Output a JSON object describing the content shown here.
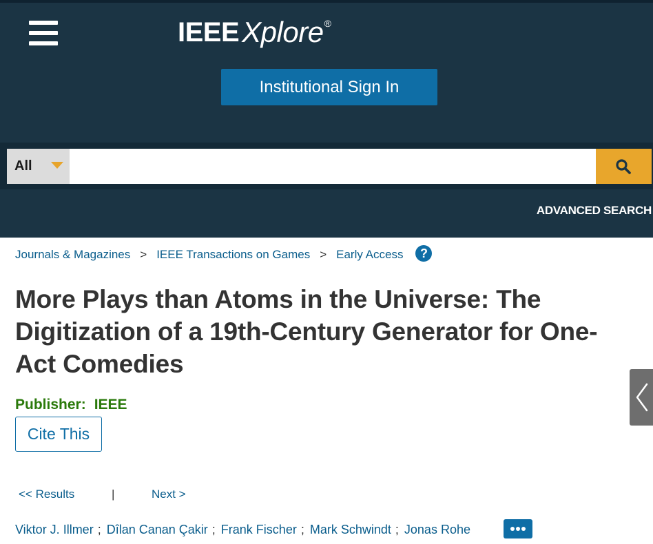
{
  "header": {
    "logo_ieee": "IEEE",
    "logo_xplore": "Xplore",
    "logo_reg": "®",
    "signin_label": "Institutional Sign In",
    "menu_icon": "hamburger-menu-icon"
  },
  "search": {
    "scope_label": "All",
    "placeholder": "",
    "value": "",
    "search_icon": "magnifier-icon",
    "advanced_label": "ADVANCED SEARCH"
  },
  "breadcrumb": {
    "items": [
      "Journals & Magazines",
      "IEEE Transactions on Games",
      "Early Access"
    ],
    "separator": ">",
    "help_glyph": "?"
  },
  "article": {
    "title": "More Plays than Atoms in the Universe: The Digitization of a 19th-Century Generator for One-Act Comedies",
    "publisher_label": "Publisher:",
    "publisher_value": "IEEE",
    "cite_label": "Cite This"
  },
  "results_nav": {
    "results_label": "<< Results",
    "divider": "|",
    "next_label": "Next >"
  },
  "authors": {
    "names": [
      "Viktor J. Illmer",
      "Dîlan Canan Çakir",
      "Frank Fischer",
      "Mark Schwindt",
      "Jonas Rohe"
    ],
    "separator": ";",
    "more_icon": "ellipsis-icon"
  },
  "colors": {
    "header_bg": "#1b3444",
    "search_band_bg": "#142a38",
    "signin_bg": "#0f6ea6",
    "search_button_bg": "#e8a62c",
    "link": "#0a5d8c",
    "title_text": "#333333",
    "publisher_green": "#2b7a0b"
  }
}
